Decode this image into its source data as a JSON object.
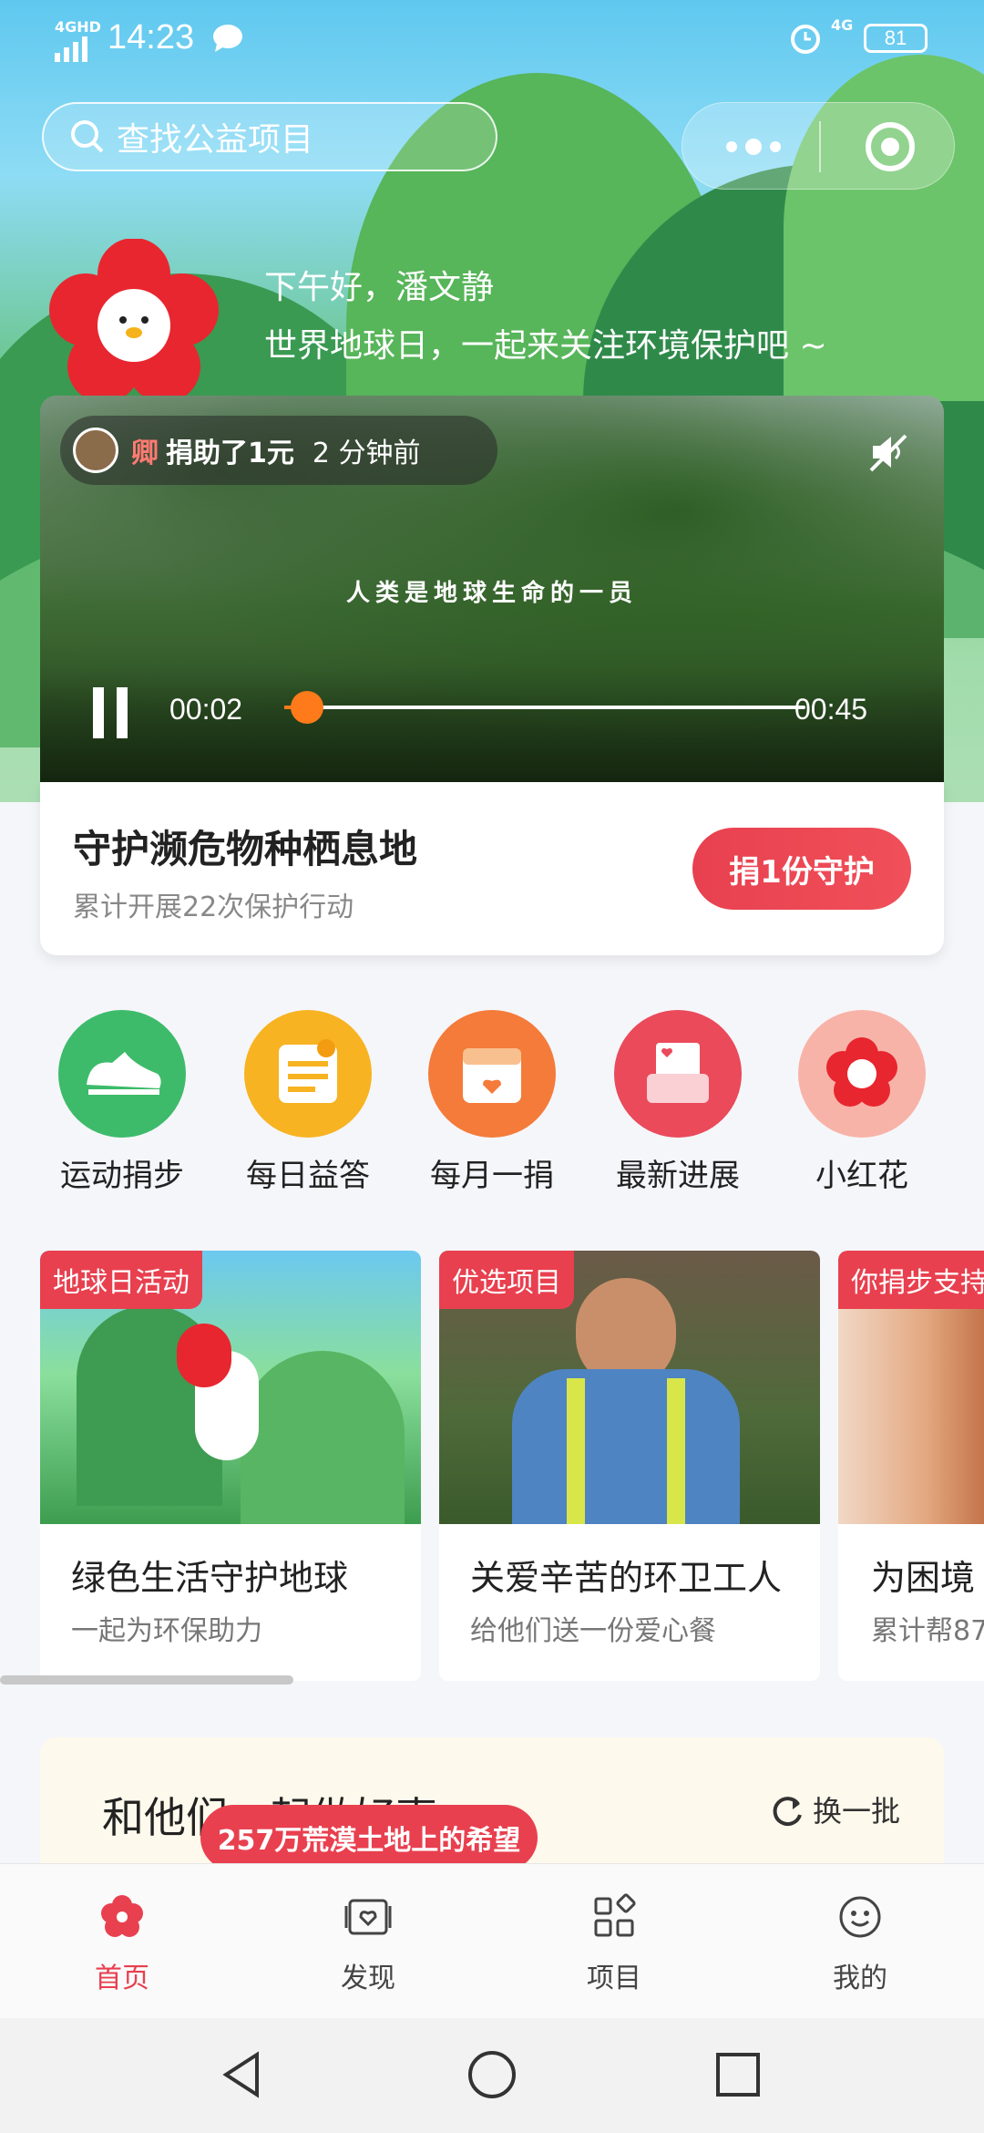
{
  "status_bar": {
    "network": "4GHD",
    "time": "14:23",
    "network_right": "4G",
    "battery": "81"
  },
  "search": {
    "placeholder": "查找公益项目"
  },
  "greeting": {
    "line1": "下午好，潘文静",
    "line2": "世界地球日，一起来关注环境保护吧 ~"
  },
  "video": {
    "donor_name": "卿",
    "donor_action": "捐助了1元",
    "donor_time": "2 分钟前",
    "caption": "人类是地球生命的一员",
    "current_time": "00:02",
    "duration": "00:45",
    "progress": 0.044
  },
  "feature": {
    "title": "守护濒危物种栖息地",
    "subtitle": "累计开展22次保护行动",
    "button": "捐1份守护"
  },
  "quick_actions": [
    {
      "label": "运动捐步",
      "icon": "sneaker-icon",
      "color": "#3dbb6a"
    },
    {
      "label": "每日益答",
      "icon": "quiz-card-icon",
      "color": "#f7b321"
    },
    {
      "label": "每月一捐",
      "icon": "calendar-icon",
      "color": "#f47b3a"
    },
    {
      "label": "最新进展",
      "icon": "inbox-icon",
      "color": "#ea4a5a"
    },
    {
      "label": "小红花",
      "icon": "red-flower-icon",
      "color": "#f69a8a"
    }
  ],
  "projects": [
    {
      "tag": "地球日活动",
      "title": "绿色生活守护地球",
      "subtitle": "一起为环保助力"
    },
    {
      "tag": "优选项目",
      "title": "关爱辛苦的环卫工人",
      "subtitle": "给他们送一份爱心餐"
    },
    {
      "tag": "你捐步支持",
      "title": "为困境",
      "subtitle": "累计帮87"
    }
  ],
  "together": {
    "title": "和他们一起做好事",
    "refresh": "换一批",
    "banner": "257万荒漠土地上的希望"
  },
  "tabs": [
    {
      "label": "首页",
      "icon": "flower-home-icon",
      "active": true
    },
    {
      "label": "发现",
      "icon": "discover-icon",
      "active": false
    },
    {
      "label": "项目",
      "icon": "grid-icon",
      "active": false
    },
    {
      "label": "我的",
      "icon": "smiley-icon",
      "active": false
    }
  ],
  "colors": {
    "accent": "#e8404f",
    "progress": "#ff7a1a"
  }
}
